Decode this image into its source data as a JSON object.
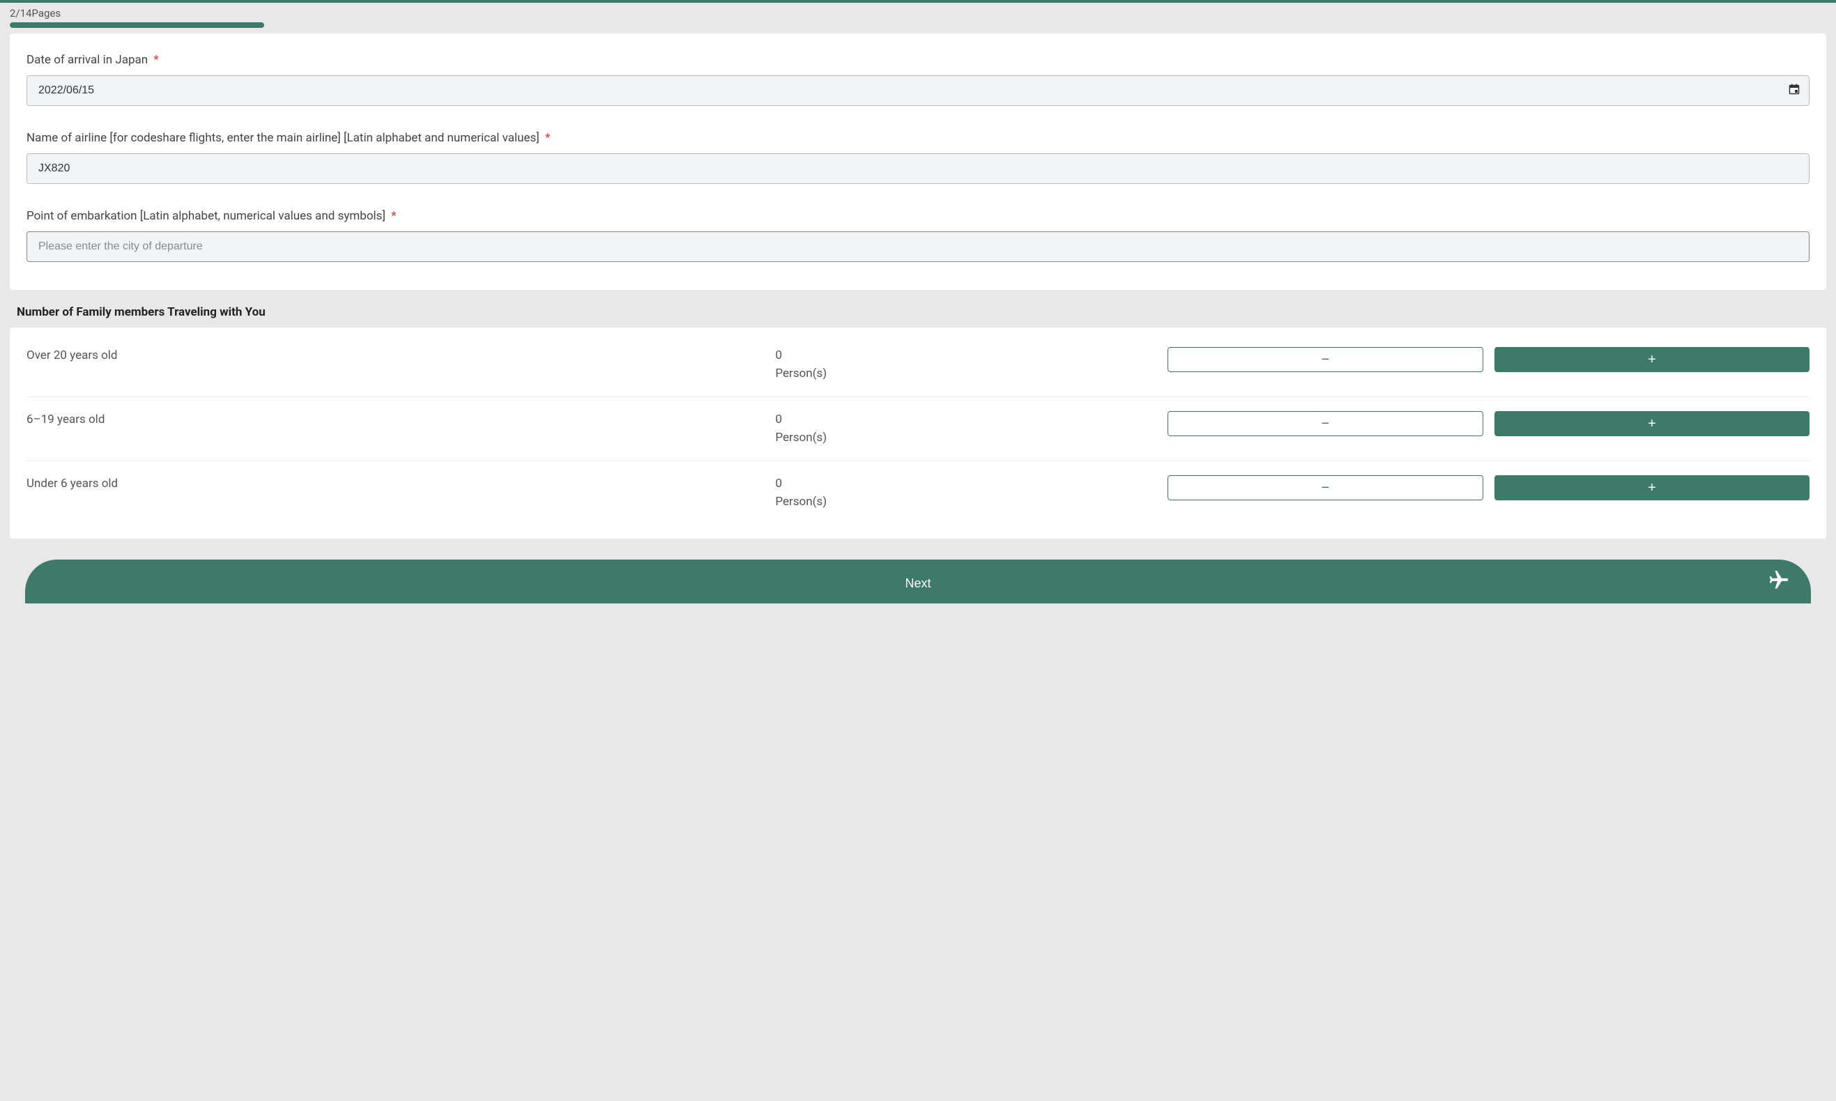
{
  "progress": {
    "label": "2/14Pages",
    "percent": 14
  },
  "form": {
    "arrival_date": {
      "label": "Date of arrival in Japan",
      "required": "*",
      "value": "2022/06/15"
    },
    "airline": {
      "label": "Name of airline [for codeshare flights, enter the main airline] [Latin alphabet and numerical values]",
      "required": "*",
      "value": "JX820"
    },
    "embarkation": {
      "label": "Point of embarkation [Latin alphabet, numerical values and symbols]",
      "required": "*",
      "placeholder": "Please enter the city of departure",
      "value": ""
    }
  },
  "family": {
    "section_title": "Number of Family members Traveling with You",
    "unit": "Person(s)",
    "minus": "−",
    "plus": "+",
    "rows": [
      {
        "label": "Over 20 years old",
        "count": "0"
      },
      {
        "label": "6–19 years old",
        "count": "0"
      },
      {
        "label": "Under 6 years old",
        "count": "0"
      }
    ]
  },
  "next_button": "Next"
}
